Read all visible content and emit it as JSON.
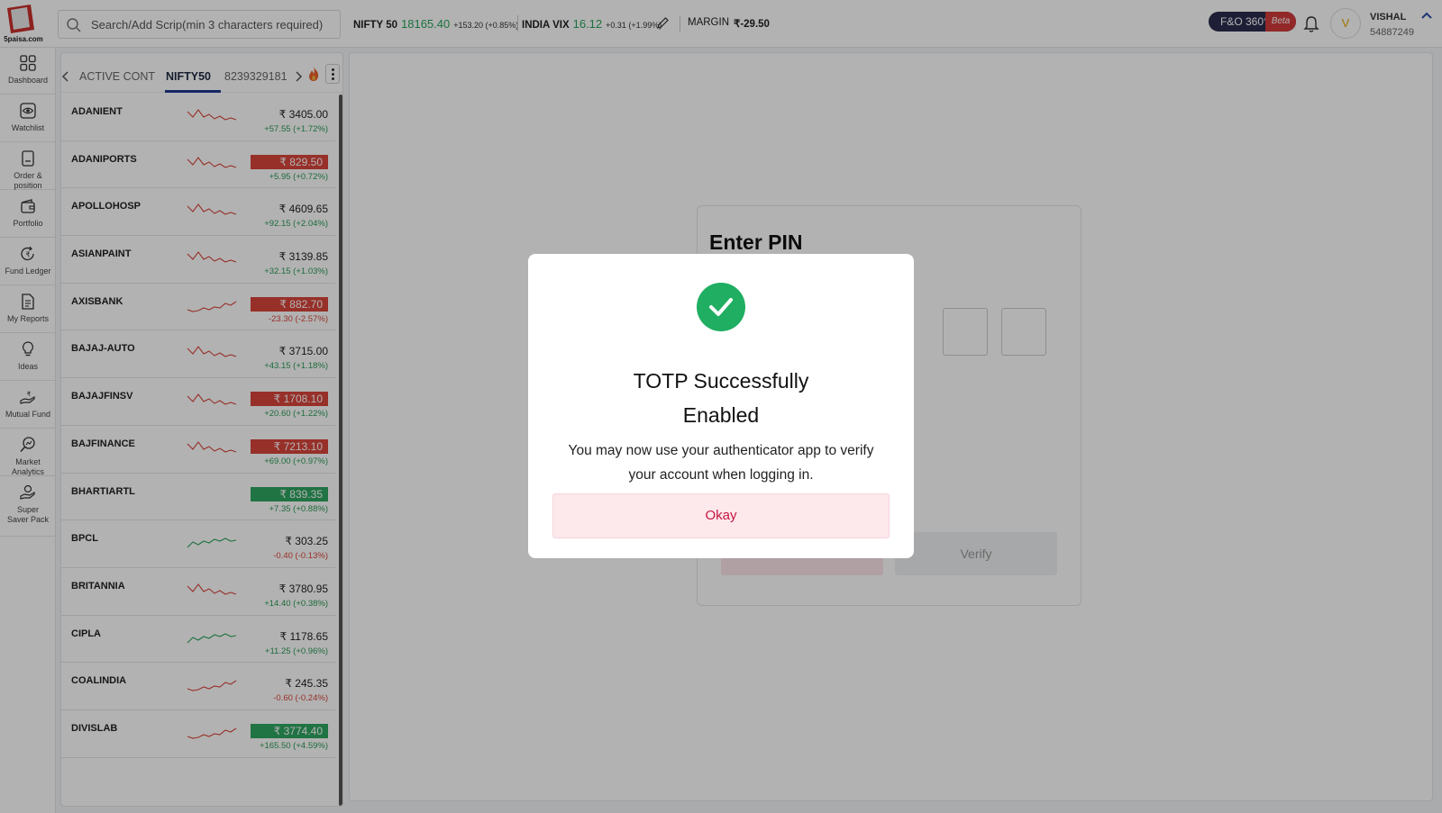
{
  "header": {
    "search_placeholder": "Search/Add Scrip(min 3 characters required)",
    "nifty_label": "NIFTY 50",
    "nifty_value": "18165.40",
    "nifty_change": "+153.20 (+0.85%)",
    "vix_label": "INDIA VIX",
    "vix_value": "16.12",
    "vix_change": "+0.31 (+1.99%)",
    "margin_label": "MARGIN",
    "margin_value": "₹-29.50",
    "fno_label": "F&O 360°",
    "fno_beta": "Beta",
    "user_initial": "V",
    "user_name": "VISHAL",
    "user_id": "54887249",
    "logo_text": "5paisa.com"
  },
  "sidebar": {
    "items": [
      {
        "label": "Dashboard",
        "icon": "dashboard-icon"
      },
      {
        "label": "Watchlist",
        "icon": "eye-icon"
      },
      {
        "label": "Order & position",
        "icon": "order-icon"
      },
      {
        "label": "Portfolio",
        "icon": "wallet-icon"
      },
      {
        "label": "Fund Ledger",
        "icon": "fund-ledger-icon"
      },
      {
        "label": "My Reports",
        "icon": "report-icon"
      },
      {
        "label": "Ideas",
        "icon": "bulb-icon"
      },
      {
        "label": "Mutual Fund",
        "icon": "mutual-fund-icon"
      },
      {
        "label": "Market Analytics",
        "icon": "analytics-icon"
      },
      {
        "label": "Super Saver Pack",
        "icon": "saver-pack-icon"
      }
    ]
  },
  "watchlist": {
    "tabs": [
      "ACTIVE CONT",
      "NIFTY50",
      "8239329181"
    ],
    "active_tab": "NIFTY50",
    "rows": [
      {
        "symbol": "ADANIENT",
        "price": "₹ 3405.00",
        "change": "+57.55 (+1.72%)",
        "highlight": "none",
        "trend": "down"
      },
      {
        "symbol": "ADANIPORTS",
        "price": "₹ 829.50",
        "change": "+5.95 (+0.72%)",
        "highlight": "red",
        "trend": "down"
      },
      {
        "symbol": "APOLLOHOSP",
        "price": "₹ 4609.65",
        "change": "+92.15 (+2.04%)",
        "highlight": "none",
        "trend": "down"
      },
      {
        "symbol": "ASIANPAINT",
        "price": "₹ 3139.85",
        "change": "+32.15 (+1.03%)",
        "highlight": "none",
        "trend": "down"
      },
      {
        "symbol": "AXISBANK",
        "price": "₹ 882.70",
        "change": "-23.30 (-2.57%)",
        "highlight": "red",
        "trend": "up"
      },
      {
        "symbol": "BAJAJ-AUTO",
        "price": "₹ 3715.00",
        "change": "+43.15 (+1.18%)",
        "highlight": "none",
        "trend": "down"
      },
      {
        "symbol": "BAJAJFINSV",
        "price": "₹ 1708.10",
        "change": "+20.60 (+1.22%)",
        "highlight": "red",
        "trend": "down"
      },
      {
        "symbol": "BAJFINANCE",
        "price": "₹ 7213.10",
        "change": "+69.00 (+0.97%)",
        "highlight": "red",
        "trend": "down"
      },
      {
        "symbol": "BHARTIARTL",
        "price": "₹ 839.35",
        "change": "+7.35 (+0.88%)",
        "highlight": "green",
        "trend": "none"
      },
      {
        "symbol": "BPCL",
        "price": "₹ 303.25",
        "change": "-0.40 (-0.13%)",
        "highlight": "none",
        "trend": "green"
      },
      {
        "symbol": "BRITANNIA",
        "price": "₹ 3780.95",
        "change": "+14.40 (+0.38%)",
        "highlight": "none",
        "trend": "down"
      },
      {
        "symbol": "CIPLA",
        "price": "₹ 1178.65",
        "change": "+11.25 (+0.96%)",
        "highlight": "none",
        "trend": "green"
      },
      {
        "symbol": "COALINDIA",
        "price": "₹ 245.35",
        "change": "-0.60 (-0.24%)",
        "highlight": "none",
        "trend": "up"
      },
      {
        "symbol": "DIVISLAB",
        "price": "₹ 3774.40",
        "change": "+165.50 (+4.59%)",
        "highlight": "green",
        "trend": "up"
      }
    ]
  },
  "pin_card": {
    "title": "Enter PIN",
    "verify_label": "Verify"
  },
  "modal": {
    "title_line1": "TOTP  Successfully",
    "title_line2": "Enabled",
    "message_line1": "You may now use your authenticator app to verify",
    "message_line2": "your account when logging in.",
    "button_label": "Okay"
  },
  "colors": {
    "positive": "#27a35a",
    "negative": "#d9453b",
    "success_check": "#1fae62",
    "okay_text": "#c8163f"
  }
}
